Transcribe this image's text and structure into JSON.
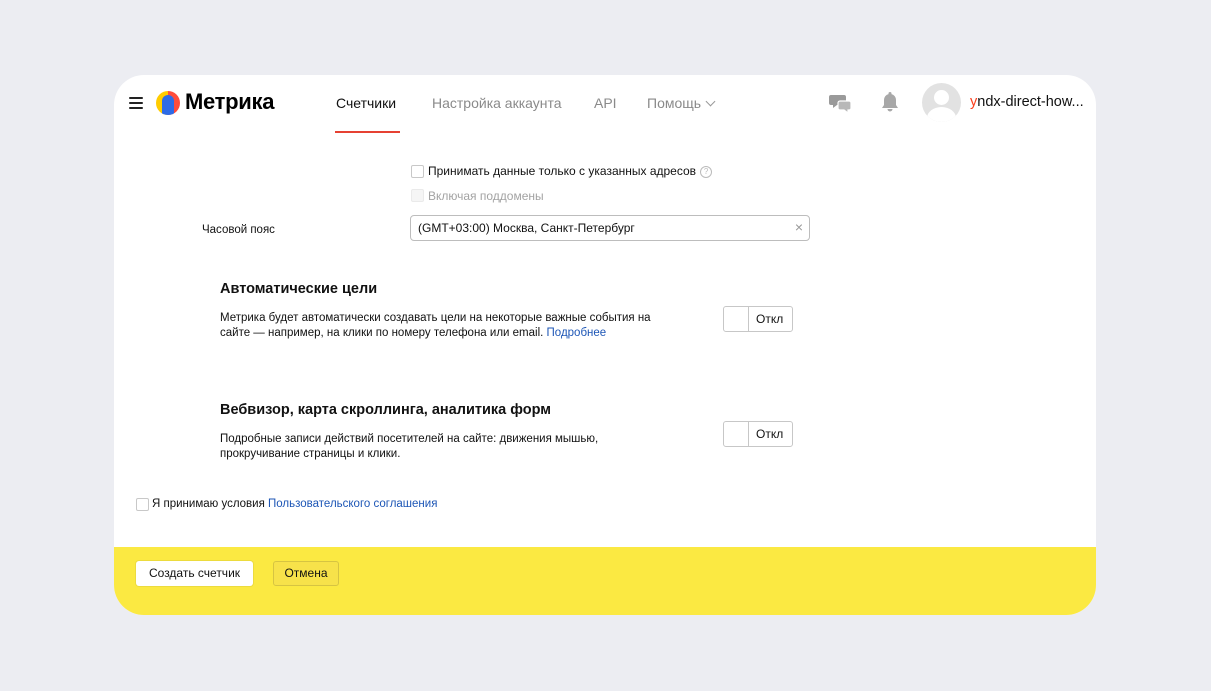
{
  "header": {
    "logo_text": "Метрика",
    "nav": [
      {
        "label": "Счетчики",
        "active": true
      },
      {
        "label": "Настройка аккаунта",
        "active": false
      },
      {
        "label": "API",
        "active": false
      },
      {
        "label": "Помощь",
        "active": false
      }
    ],
    "username_first": "y",
    "username_rest": "ndx-direct-how..."
  },
  "form": {
    "accept_only_label": "Принимать данные только с указанных адресов",
    "accept_only_help": "?",
    "include_subdomains_label": "Включая поддомены",
    "timezone_label": "Часовой пояс",
    "timezone_value": "(GMT+03:00) Москва, Санкт-Петербург",
    "auto_goals": {
      "title": "Автоматические цели",
      "desc_line1": "Метрика будет автоматически создавать цели на некоторые важные события на",
      "desc_line2": "сайте — например, на клики по номеру телефона или email.",
      "link": "Подробнее",
      "toggle_label": "Откл"
    },
    "webvisor": {
      "title": "Вебвизор, карта скроллинга, аналитика форм",
      "desc_line1": "Подробные записи действий посетителей на сайте: движения мышью,",
      "desc_line2": "прокручивание страницы и клики.",
      "toggle_label": "Откл"
    },
    "agreement_text": "Я принимаю условия",
    "agreement_link": "Пользовательского соглашения"
  },
  "footer": {
    "create_label": "Создать счетчик",
    "cancel_label": "Отмена"
  },
  "colors": {
    "accent_red": "#e64132",
    "footer_yellow": "#fbe942",
    "link_blue": "#1d56b6"
  }
}
